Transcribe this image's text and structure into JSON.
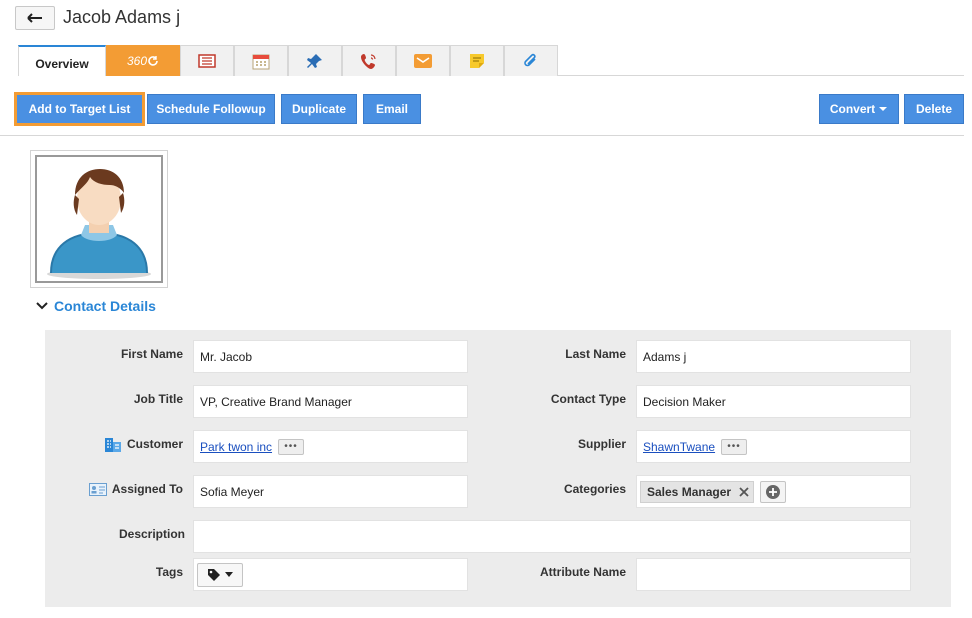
{
  "page": {
    "title": "Jacob Adams j"
  },
  "tabs": [
    {
      "label": "Overview",
      "icon": "overview"
    },
    {
      "label": "360",
      "icon": "refresh-icon"
    },
    {
      "label": "",
      "icon": "notes-icon"
    },
    {
      "label": "",
      "icon": "calendar-icon"
    },
    {
      "label": "",
      "icon": "pin-icon"
    },
    {
      "label": "",
      "icon": "phone-icon"
    },
    {
      "label": "",
      "icon": "mail-icon"
    },
    {
      "label": "",
      "icon": "sticky-note-icon"
    },
    {
      "label": "",
      "icon": "attachment-icon"
    }
  ],
  "toolbar": {
    "add_to_target_list": "Add to Target List",
    "schedule_followup": "Schedule Followup",
    "duplicate": "Duplicate",
    "email": "Email",
    "convert": "Convert",
    "delete": "Delete"
  },
  "section": {
    "title": "Contact Details"
  },
  "fields": {
    "first_name": {
      "label": "First Name",
      "value": "Mr. Jacob"
    },
    "last_name": {
      "label": "Last Name",
      "value": "Adams j"
    },
    "job_title": {
      "label": "Job Title",
      "value": "VP, Creative Brand Manager"
    },
    "contact_type": {
      "label": "Contact Type",
      "value": "Decision Maker"
    },
    "customer": {
      "label": "Customer",
      "value": "Park twon inc"
    },
    "supplier": {
      "label": "Supplier",
      "value": "ShawnTwane"
    },
    "assigned_to": {
      "label": "Assigned To",
      "value": "Sofia Meyer"
    },
    "categories": {
      "label": "Categories",
      "value": "Sales Manager"
    },
    "description": {
      "label": "Description",
      "value": ""
    },
    "tags": {
      "label": "Tags",
      "value": ""
    },
    "attribute_name": {
      "label": "Attribute Name",
      "value": ""
    }
  },
  "colors": {
    "accent": "#4a90e2",
    "highlight": "#f39c34",
    "link": "#2a86d6"
  }
}
